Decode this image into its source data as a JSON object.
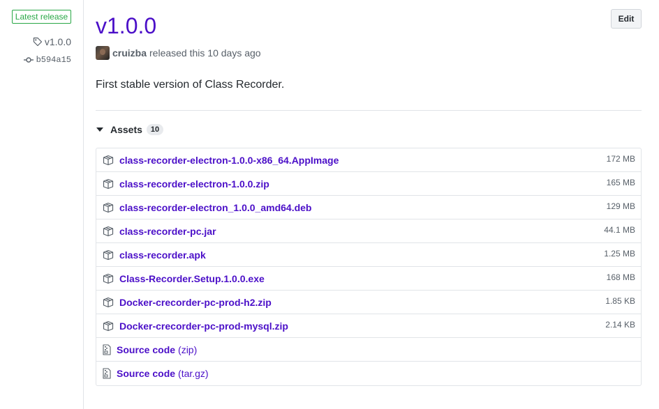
{
  "meta": {
    "latest_badge": "Latest release",
    "tag": "v1.0.0",
    "commit": "b594a15"
  },
  "release": {
    "title": "v1.0.0",
    "edit_label": "Edit",
    "author": "cruizba",
    "released_text": "released this 10 days ago",
    "body": "First stable version of Class Recorder."
  },
  "assets": {
    "header": "Assets",
    "count": "10",
    "items": [
      {
        "name": "class-recorder-electron-1.0.0-x86_64.AppImage",
        "size": "172 MB"
      },
      {
        "name": "class-recorder-electron-1.0.0.zip",
        "size": "165 MB"
      },
      {
        "name": "class-recorder-electron_1.0.0_amd64.deb",
        "size": "129 MB"
      },
      {
        "name": "class-recorder-pc.jar",
        "size": "44.1 MB"
      },
      {
        "name": "class-recorder.apk",
        "size": "1.25 MB"
      },
      {
        "name": "Class-Recorder.Setup.1.0.0.exe",
        "size": "168 MB"
      },
      {
        "name": "Docker-crecorder-pc-prod-h2.zip",
        "size": "1.85 KB"
      },
      {
        "name": "Docker-crecorder-pc-prod-mysql.zip",
        "size": "2.14 KB"
      }
    ],
    "sources": [
      {
        "label": "Source code",
        "ext": "(zip)"
      },
      {
        "label": "Source code",
        "ext": "(tar.gz)"
      }
    ]
  },
  "colors": {
    "link": "#4b0fc8",
    "badge_green": "#28a745",
    "muted": "#586069"
  },
  "icons": {
    "tag": "tag-icon",
    "commit": "git-commit-icon",
    "asset": "package-icon",
    "source": "file-zip-icon",
    "caret": "triangle-down-icon"
  }
}
